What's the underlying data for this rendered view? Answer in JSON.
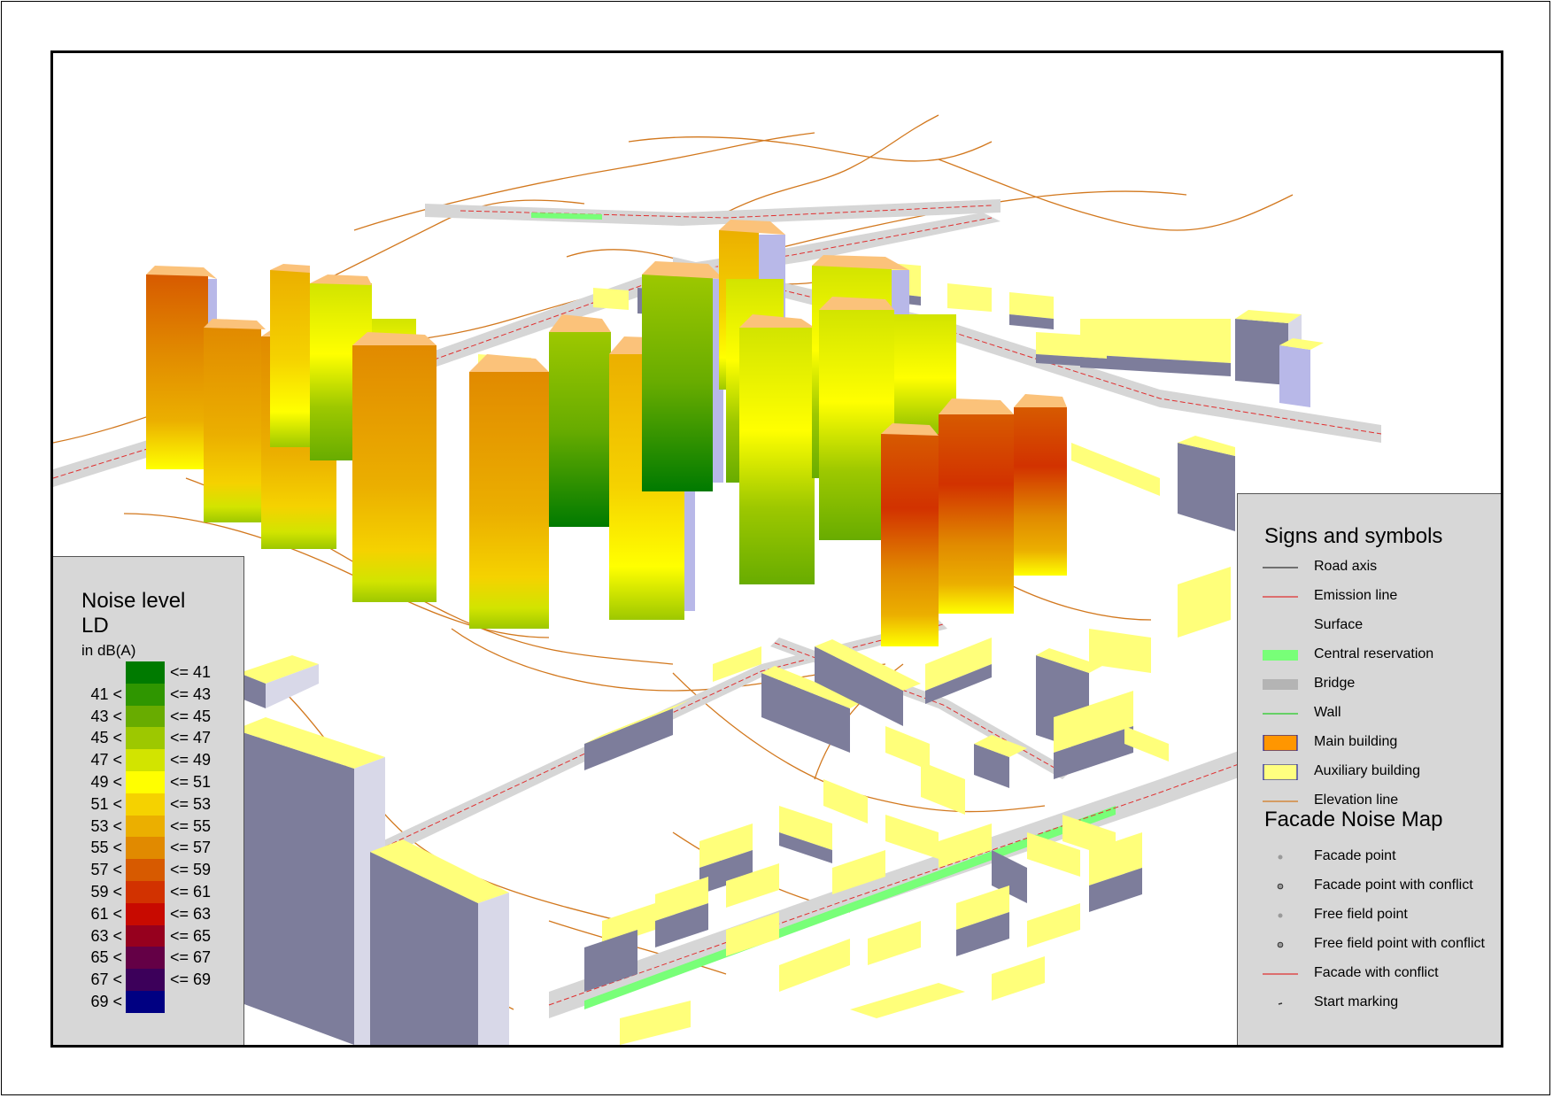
{
  "noise_legend": {
    "title_line1": "Noise level",
    "title_line2": "LD",
    "unit": "in dB(A)",
    "classes": [
      {
        "low": "",
        "high": "<= 41",
        "color": "#007a00"
      },
      {
        "low": "41 <",
        "high": "<= 43",
        "color": "#2f9600"
      },
      {
        "low": "43 <",
        "high": "<= 45",
        "color": "#68ac00"
      },
      {
        "low": "45 <",
        "high": "<= 47",
        "color": "#9dc800"
      },
      {
        "low": "47 <",
        "high": "<= 49",
        "color": "#d2e400"
      },
      {
        "low": "49 <",
        "high": "<= 51",
        "color": "#ffff00"
      },
      {
        "low": "51 <",
        "high": "<= 53",
        "color": "#f5d200"
      },
      {
        "low": "53 <",
        "high": "<= 55",
        "color": "#ebaf00"
      },
      {
        "low": "55 <",
        "high": "<= 57",
        "color": "#e18a00"
      },
      {
        "low": "57 <",
        "high": "<= 59",
        "color": "#d75a00"
      },
      {
        "low": "59 <",
        "high": "<= 61",
        "color": "#d23200"
      },
      {
        "low": "61 <",
        "high": "<= 63",
        "color": "#c80a00"
      },
      {
        "low": "63 <",
        "high": "<= 65",
        "color": "#96001e"
      },
      {
        "low": "65 <",
        "high": "<= 67",
        "color": "#640046"
      },
      {
        "low": "67 <",
        "high": "<= 69",
        "color": "#3c005a"
      },
      {
        "low": "69 <",
        "high": "",
        "color": "#000082"
      }
    ]
  },
  "symbols_legend": {
    "title": "Signs and symbols",
    "items": [
      {
        "label": "Road axis",
        "icon": "thin-line",
        "color": "#333333"
      },
      {
        "label": "Emission line",
        "icon": "thin-line",
        "color": "#e03030"
      },
      {
        "label": "Surface",
        "icon": "none",
        "color": ""
      },
      {
        "label": "Central reservation",
        "icon": "fill",
        "color": "#78ff78"
      },
      {
        "label": "Bridge",
        "icon": "fill",
        "color": "#b4b4b4"
      },
      {
        "label": "Wall",
        "icon": "thin-line",
        "color": "#22cc22"
      },
      {
        "label": "Main building",
        "icon": "box",
        "color": "#ff9600"
      },
      {
        "label": "Auxiliary building",
        "icon": "box",
        "color": "#ffff80"
      },
      {
        "label": "Elevation line",
        "icon": "thin-line",
        "color": "#d2781e"
      }
    ],
    "facade_title": "Facade Noise Map",
    "facade_items": [
      {
        "label": "Facade point",
        "icon": "dot-fill"
      },
      {
        "label": "Facade point with conflict",
        "icon": "dot-ring"
      },
      {
        "label": "Free field point",
        "icon": "dot-fill"
      },
      {
        "label": "Free field point with conflict",
        "icon": "dot-ring"
      },
      {
        "label": "Facade with conflict",
        "icon": "thin-line",
        "color": "#e03030"
      },
      {
        "label": "Start marking",
        "icon": "tick"
      }
    ]
  },
  "colors": {
    "building_side": "#7d7d9b",
    "building_roof": "#ffff7a",
    "tower_roof": "#fbc27a",
    "road": "#d6d6d6",
    "elevation": "#d2781e",
    "emission": "#e03030",
    "central_reservation": "#78ff78"
  }
}
